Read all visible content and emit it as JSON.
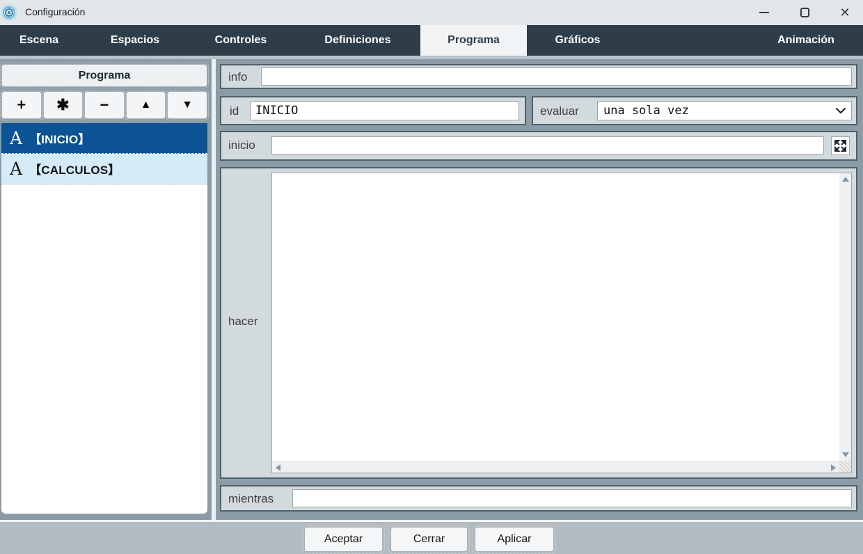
{
  "window": {
    "title": "Configuración",
    "controls": {
      "minimize": "minimize",
      "maximize": "maximize",
      "close": "✕"
    }
  },
  "tabs": [
    {
      "label": "Escena",
      "selected": false
    },
    {
      "label": "Espacios",
      "selected": false
    },
    {
      "label": "Controles",
      "selected": false
    },
    {
      "label": "Definiciones",
      "selected": false
    },
    {
      "label": "Programa",
      "selected": true
    },
    {
      "label": "Gráficos",
      "selected": false
    },
    {
      "label": "Animación",
      "selected": false
    }
  ],
  "left_panel": {
    "header": "Programa",
    "toolbar": [
      {
        "name": "add",
        "glyph": "+"
      },
      {
        "name": "duplicate",
        "glyph": "✱"
      },
      {
        "name": "remove",
        "glyph": "−"
      },
      {
        "name": "move-up",
        "glyph": "▲"
      },
      {
        "name": "move-down",
        "glyph": "▼"
      }
    ],
    "items": [
      {
        "prefix": "A",
        "label": "【INICIO】",
        "selected": true
      },
      {
        "prefix": "A",
        "label": "【CALCULOS】",
        "selected": false
      }
    ]
  },
  "form": {
    "info": {
      "label": "info",
      "value": ""
    },
    "id": {
      "label": "id",
      "value": "INICIO"
    },
    "evaluar": {
      "label": "evaluar",
      "value": "una sola vez"
    },
    "inicio": {
      "label": "inicio",
      "value": ""
    },
    "hacer": {
      "label": "hacer",
      "value": ""
    },
    "mientras": {
      "label": "mientras",
      "value": ""
    }
  },
  "footer": {
    "accept": "Aceptar",
    "close": "Cerrar",
    "apply": "Aplicar"
  },
  "colors": {
    "selected_item": "#0b5394",
    "alt_item": "#d5ebf8",
    "tabbar": "#2e3d48",
    "content_bg": "#8b9ca6",
    "row_bg": "#d3dade",
    "footer_bg": "#b3bbc2"
  },
  "icons": {
    "app": "descartes-spiral-icon",
    "expand": "expand-arrows-icon",
    "dropdown": "chevron-down-icon"
  }
}
